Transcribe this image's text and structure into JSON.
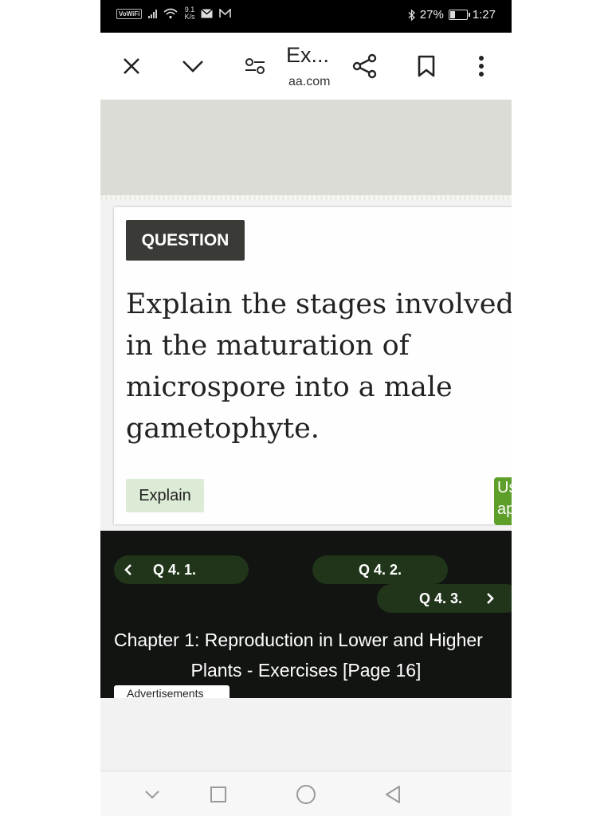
{
  "status_bar": {
    "volte": "VoWiFi",
    "speed_value": "9.1",
    "speed_unit": "K/s",
    "battery_percent": "27%",
    "battery_level": 0.27,
    "time": "1:27"
  },
  "toolbar": {
    "title": "Ex...",
    "domain": "aa.com"
  },
  "question_card": {
    "badge": "QUESTION",
    "text": "Explain the stages involved in the maturation of microspore into a male gametophyte.",
    "tag": "Explain",
    "side_tab_line1": "Us",
    "side_tab_line2": "ap"
  },
  "navigation": {
    "prev_label": "Q 4. 1.",
    "current_label": "Q 4. 2.",
    "next_label": "Q 4. 3.",
    "chapter_line1": "Chapter 1: Reproduction in Lower and Higher",
    "chapter_line2": "Plants - Exercises [Page 16]"
  },
  "ads": {
    "label": "Advertisements"
  },
  "colors": {
    "badge_bg": "#3a3b37",
    "tag_bg": "#dcebd5",
    "accent_green": "#5e9f2a",
    "nav_bg": "#111410",
    "pill_bg": "#20351a"
  }
}
